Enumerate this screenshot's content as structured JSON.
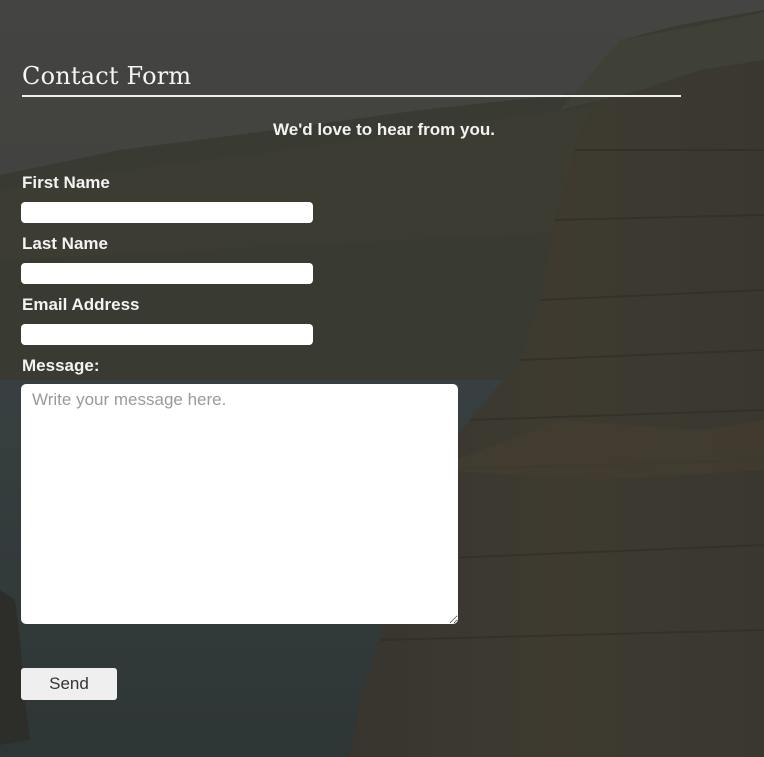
{
  "form": {
    "title": "Contact Form",
    "subtitle": "We'd love to hear from you.",
    "fields": {
      "first_name": {
        "label": "First Name",
        "value": ""
      },
      "last_name": {
        "label": "Last Name",
        "value": ""
      },
      "email": {
        "label": "Email Address",
        "value": ""
      },
      "message": {
        "label": "Message:",
        "placeholder": "Write your message here."
      }
    },
    "send_label": "Send"
  },
  "colors": {
    "overlay": "#3a3b39",
    "text": "#f3f3f3",
    "input_bg": "#ffffff",
    "button_bg": "#efefef"
  }
}
